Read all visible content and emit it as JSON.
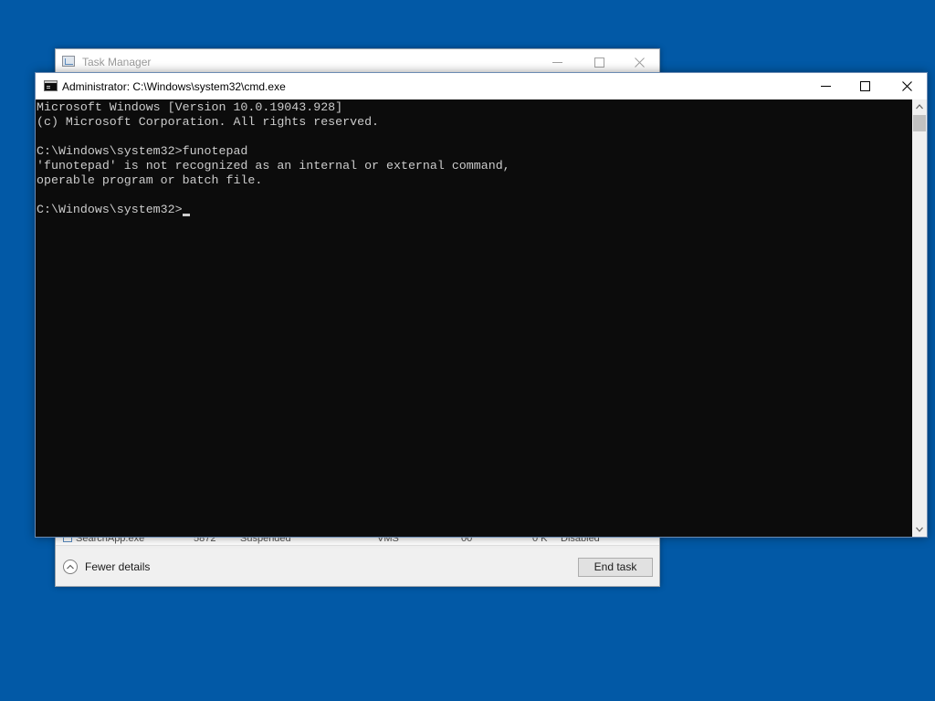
{
  "task_manager": {
    "title": "Task Manager",
    "partial_row": {
      "name": "SearchApp.exe",
      "pid": "5872",
      "status": "Suspended",
      "user": "VMS",
      "cpu": "00",
      "memory": "0 K",
      "uac": "Disabled"
    },
    "fewer_details_label": "Fewer details",
    "end_task_label": "End task"
  },
  "cmd": {
    "title": "Administrator: C:\\Windows\\system32\\cmd.exe",
    "lines": [
      "Microsoft Windows [Version 10.0.19043.928]",
      "(c) Microsoft Corporation. All rights reserved.",
      "",
      "C:\\Windows\\system32>funotepad",
      "'funotepad' is not recognized as an internal or external command,",
      "operable program or batch file.",
      "",
      "C:\\Windows\\system32>"
    ]
  },
  "colors": {
    "desktop": "#0259a6",
    "console_bg": "#0c0c0c",
    "console_text": "#cccccc"
  },
  "icons": {
    "task_manager_app": "task-manager-icon",
    "cmd_app": "cmd-icon",
    "minimize": "minimize-icon",
    "maximize": "maximize-icon",
    "close": "close-icon",
    "fewer_details": "chevron-up-icon",
    "scroll_up": "scroll-up-arrow-icon",
    "scroll_down": "scroll-down-arrow-icon"
  }
}
